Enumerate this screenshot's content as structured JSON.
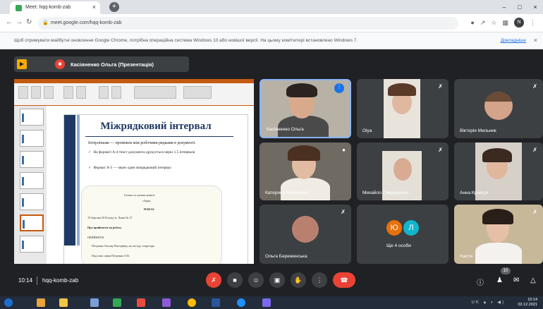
{
  "browser": {
    "tab_title": "Meet: hqq-komb-zab",
    "tab_close": "×",
    "new_tab": "+",
    "window_controls": [
      "–",
      "□",
      "×"
    ],
    "url": "meet.google.com/hqq-komb-zab",
    "back": "←",
    "forward": "→",
    "reload": "↻",
    "profile_initial": "N",
    "toolbar_icons": [
      "camera-icon",
      "share-icon",
      "star-icon",
      "puzzle-icon"
    ],
    "infobar_text": "Щоб отримувати майбутні оновлення Google Chrome, потрібна операційна система Windows 10 або новішої версії. На цьому комп'ютері встановлено Windows 7.",
    "infobar_more": "Докладніше",
    "infobar_close": "×"
  },
  "meet": {
    "presenter_label": "Касіяненко Ольга (Презентація)",
    "presentation": {
      "slide_title": "Міжрядковий інтервал",
      "definition": "Інтерліньяж — проміжок між робочими рядками в документі.",
      "bullet1": "На форматі А-4 текст документа друкується через 1,5 інтервали",
      "bullet2": "Формат А-5 — через один міжрядковий інтервал",
      "example_lines": [
        "Голова та членам комісії",
        "«Зоря»",
        "НАКАЗ",
        "15 березня 2016 року          м. Львів          № 27",
        "Про прийняття на роботу",
        "ПРИЙНЯТИ:",
        "Петренко Оксану Вікторівну на посаду секретаря.",
        "Підстава: заява Петренко О.В."
      ]
    },
    "participants": [
      {
        "name": "Касіяненко Ольга"
      },
      {
        "name": "Olya"
      },
      {
        "name": "Вікторія Мельник"
      },
      {
        "name": "Катерина Кравченко"
      },
      {
        "name": "Михайло Свириденко"
      },
      {
        "name": "Анна Кравчук"
      },
      {
        "name": "Ольга Береженська"
      },
      {
        "name": "Ще 4 особи",
        "avatars": [
          "Ю",
          "Л"
        ]
      },
      {
        "name": "Настя"
      }
    ],
    "bottom_bar": {
      "time": "10:14",
      "meeting_code": "hqq-komb-zab",
      "people_count": "10"
    }
  },
  "taskbar": {
    "time": "10:14",
    "date": "02.12.2021",
    "system_tray": "UK ▲ ◐ ◀)"
  },
  "colors": {
    "meet_bg": "#202124",
    "tile_bg": "#3c4043",
    "end_call": "#ea4335",
    "slide_accent": "#1f3864",
    "ribbon": "#c55a11"
  }
}
